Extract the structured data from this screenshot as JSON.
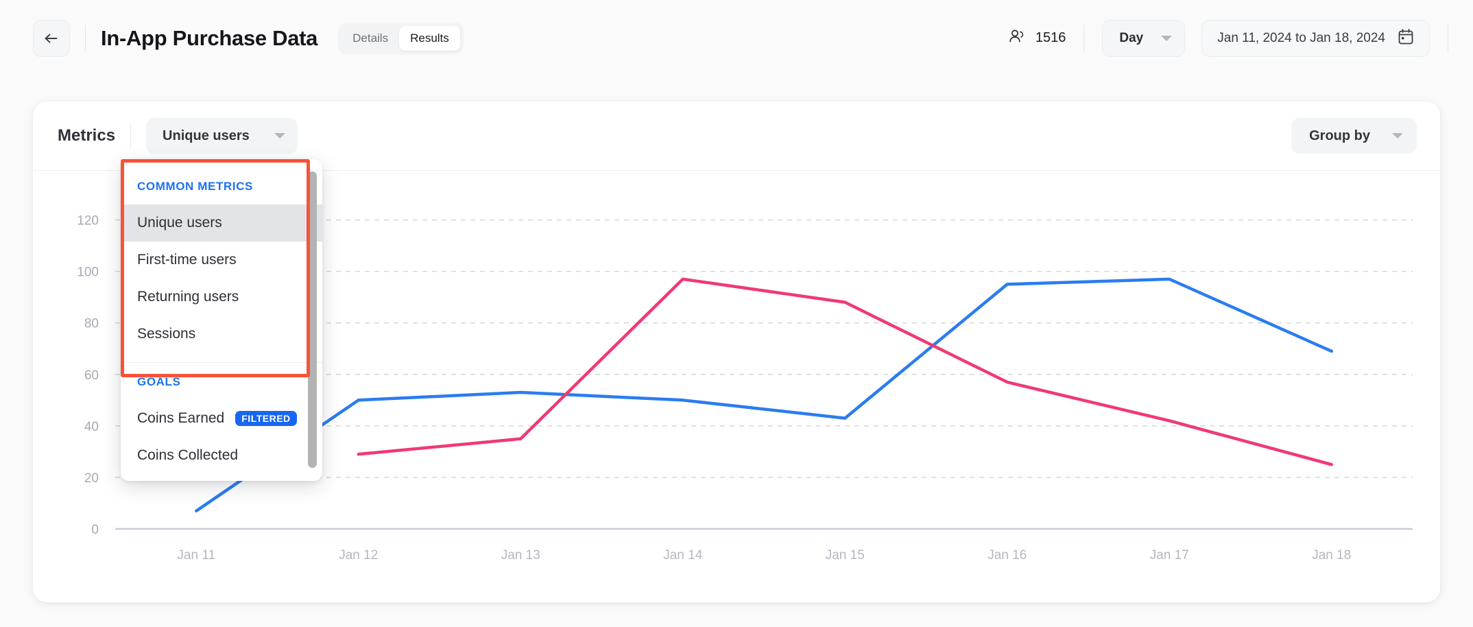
{
  "header": {
    "back_icon": "arrow-left-icon",
    "title": "In-App Purchase Data",
    "tabs": [
      {
        "label": "Details",
        "active": false
      },
      {
        "label": "Results",
        "active": true
      }
    ],
    "users_icon": "users-icon",
    "users_count": "1516",
    "granularity": {
      "label": "Day",
      "caret_icon": "chevron-down-icon"
    },
    "date_range": {
      "label": "Jan 11, 2024 to Jan 18, 2024",
      "calendar_icon": "calendar-icon"
    }
  },
  "card": {
    "metrics_label": "Metrics",
    "metric_select": {
      "label": "Unique users",
      "caret_icon": "chevron-down-icon"
    },
    "group_by": {
      "label": "Group by",
      "caret_icon": "chevron-down-icon"
    }
  },
  "dropdown": {
    "sections": [
      {
        "title": "COMMON METRICS",
        "items": [
          {
            "label": "Unique users",
            "selected": true
          },
          {
            "label": "First-time users",
            "selected": false
          },
          {
            "label": "Returning users",
            "selected": false
          },
          {
            "label": "Sessions",
            "selected": false
          }
        ]
      },
      {
        "title": "GOALS",
        "items": [
          {
            "label": "Coins Earned",
            "badge": "FILTERED",
            "selected": false
          },
          {
            "label": "Coins Collected",
            "selected": false
          }
        ]
      }
    ],
    "highlight_color": "#f75339",
    "section_title_color": "#1c72f0",
    "badge_color": "#1767f2"
  },
  "chart_data": {
    "type": "line",
    "title": "",
    "xlabel": "",
    "ylabel": "",
    "x": [
      "Jan 11",
      "Jan 12",
      "Jan 13",
      "Jan 14",
      "Jan 15",
      "Jan 16",
      "Jan 17",
      "Jan 18"
    ],
    "yticks": [
      0,
      20,
      40,
      60,
      80,
      100,
      120
    ],
    "ylim": [
      0,
      130
    ],
    "grid": true,
    "legend": "none",
    "series": [
      {
        "name": "Unique users",
        "color": "#2b7cf0",
        "values": [
          7,
          50,
          53,
          50,
          43,
          95,
          97,
          69
        ]
      },
      {
        "name": "Coins Earned",
        "color": "#ef3a74",
        "values": [
          null,
          29,
          35,
          97,
          88,
          57,
          42,
          25
        ]
      }
    ]
  }
}
